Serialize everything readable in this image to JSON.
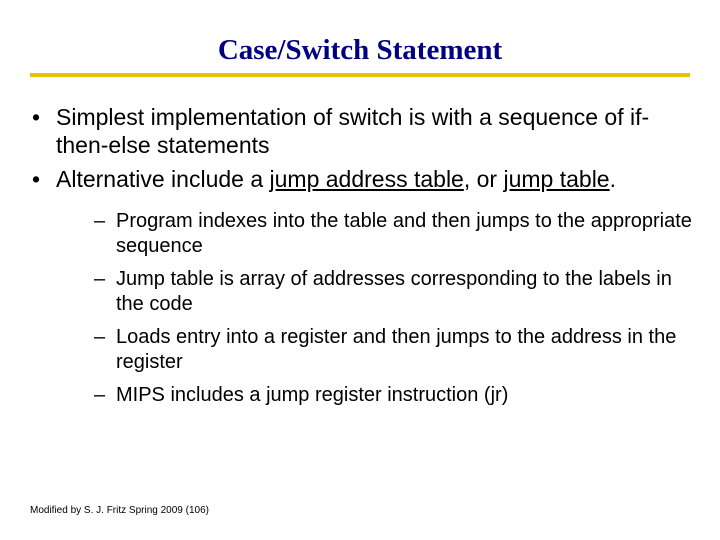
{
  "title": "Case/Switch Statement",
  "bullets": {
    "b1": "Simplest implementation of switch is with a sequence of if-then-else statements",
    "b2_pre": "Alternative include a ",
    "b2_link1": "jump address table",
    "b2_mid": ", or ",
    "b2_link2": "jump table",
    "b2_post": "."
  },
  "sub": {
    "s1": "Program indexes into the table and then jumps to the appropriate sequence",
    "s2": "Jump table is array of addresses corresponding to the labels in the code",
    "s3": "Loads entry into a register and then jumps to the address in the register",
    "s4": "MIPS includes a jump register instruction (jr)"
  },
  "footer": "Modified by S. J. Fritz  Spring 2009 (106)"
}
